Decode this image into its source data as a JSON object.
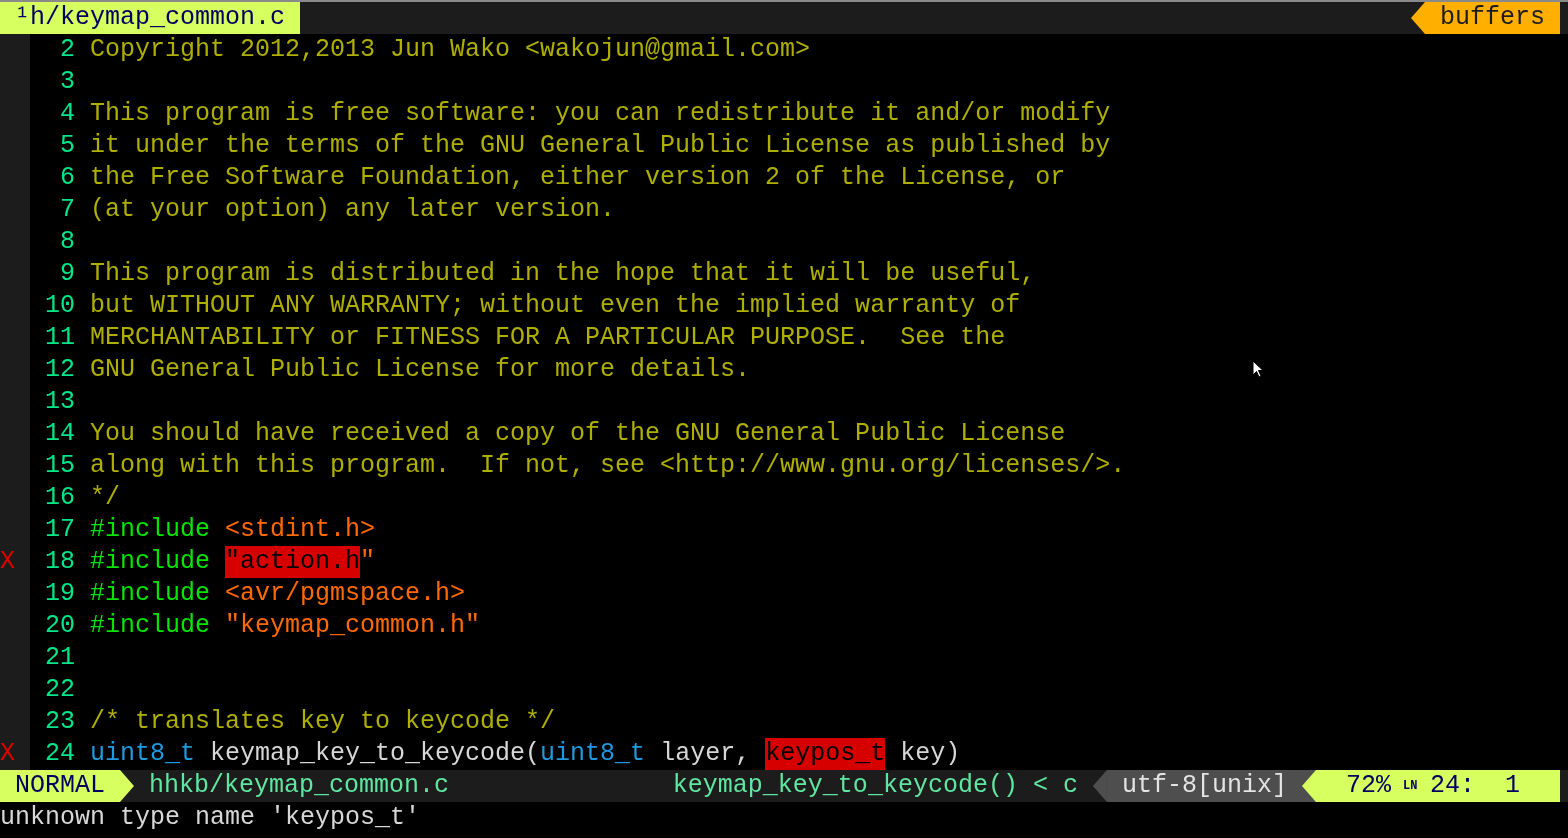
{
  "tabline": {
    "tab": {
      "label": "¹h/keymap_common.c",
      "selected": true
    },
    "buffers_label": "buffers"
  },
  "lines": [
    {
      "number": "2",
      "segments": [
        {
          "text": "Copyright 2012,2013 Jun Wako <wakojun@gmail.com>",
          "kind": "comment"
        }
      ]
    },
    {
      "number": "3"
    },
    {
      "number": "4",
      "segments": [
        {
          "text": "This program is free software: you can redistribute it and/or modify",
          "kind": "comment"
        }
      ]
    },
    {
      "number": "5",
      "segments": [
        {
          "text": "it under the terms of the GNU General Public License as published by",
          "kind": "comment"
        }
      ]
    },
    {
      "number": "6",
      "segments": [
        {
          "text": "the Free Software Foundation, either version 2 of the License, or",
          "kind": "comment"
        }
      ]
    },
    {
      "number": "7",
      "segments": [
        {
          "text": "(at your option) any later version.",
          "kind": "comment"
        }
      ]
    },
    {
      "number": "8"
    },
    {
      "number": "9",
      "segments": [
        {
          "text": "This program is distributed in the hope that it will be useful,",
          "kind": "comment"
        }
      ]
    },
    {
      "number": "10",
      "segments": [
        {
          "text": "but WITHOUT ANY WARRANTY; without even the implied warranty of",
          "kind": "comment"
        }
      ]
    },
    {
      "number": "11",
      "segments": [
        {
          "text": "MERCHANTABILITY or FITNESS FOR A PARTICULAR PURPOSE.  See the",
          "kind": "comment"
        }
      ]
    },
    {
      "number": "12",
      "segments": [
        {
          "text": "GNU General Public License for more details.",
          "kind": "comment"
        }
      ]
    },
    {
      "number": "13"
    },
    {
      "number": "14",
      "segments": [
        {
          "text": "You should have received a copy of the GNU General Public License",
          "kind": "comment"
        }
      ]
    },
    {
      "number": "15",
      "segments": [
        {
          "text": "along with this program.  If not, see <http://www.gnu.org/licenses/>.",
          "kind": "comment"
        }
      ]
    },
    {
      "number": "16",
      "segments": [
        {
          "text": "*/",
          "kind": "comment"
        }
      ]
    },
    {
      "number": "17",
      "segments": [
        {
          "text": "#include",
          "kind": "preproc"
        },
        {
          "text": " <stdint.h>",
          "kind": "string"
        }
      ]
    },
    {
      "number": "18",
      "sign": "X",
      "segments": [
        {
          "text": "#include ",
          "kind": "preproc"
        },
        {
          "text": "\"action.h",
          "kind": "error"
        },
        {
          "text": "\"",
          "kind": "string"
        }
      ]
    },
    {
      "number": "19",
      "segments": [
        {
          "text": "#include",
          "kind": "preproc"
        },
        {
          "text": " <avr/pgmspace.h>",
          "kind": "string"
        }
      ]
    },
    {
      "number": "20",
      "segments": [
        {
          "text": "#include",
          "kind": "preproc"
        },
        {
          "text": " \"keymap_common.h\"",
          "kind": "string"
        }
      ]
    },
    {
      "number": "21"
    },
    {
      "number": "22"
    },
    {
      "number": "23",
      "segments": [
        {
          "text": "/* translates key to keycode */",
          "kind": "comment"
        }
      ]
    },
    {
      "number": "24",
      "sign": "X",
      "segments": [
        {
          "text": "uint8_t",
          "kind": "type"
        },
        {
          "text": " keymap_key_to_keycode(",
          "kind": "normal"
        },
        {
          "text": "uint8_t",
          "kind": "type"
        },
        {
          "text": " layer, ",
          "kind": "normal"
        },
        {
          "text": "keypos_t",
          "kind": "error"
        },
        {
          "text": " key)",
          "kind": "normal"
        }
      ]
    }
  ],
  "status_bar": {
    "mode": "NORMAL",
    "file": "hhkb/keymap_common.c",
    "function": "keymap_key_to_keycode()",
    "separator": "<",
    "filetype": "c",
    "encoding": "utf-8[unix]",
    "percent": "72%",
    "line_symbol": "LN",
    "position": "24:  1"
  },
  "command_line": "unknown type name 'keypos_t'"
}
